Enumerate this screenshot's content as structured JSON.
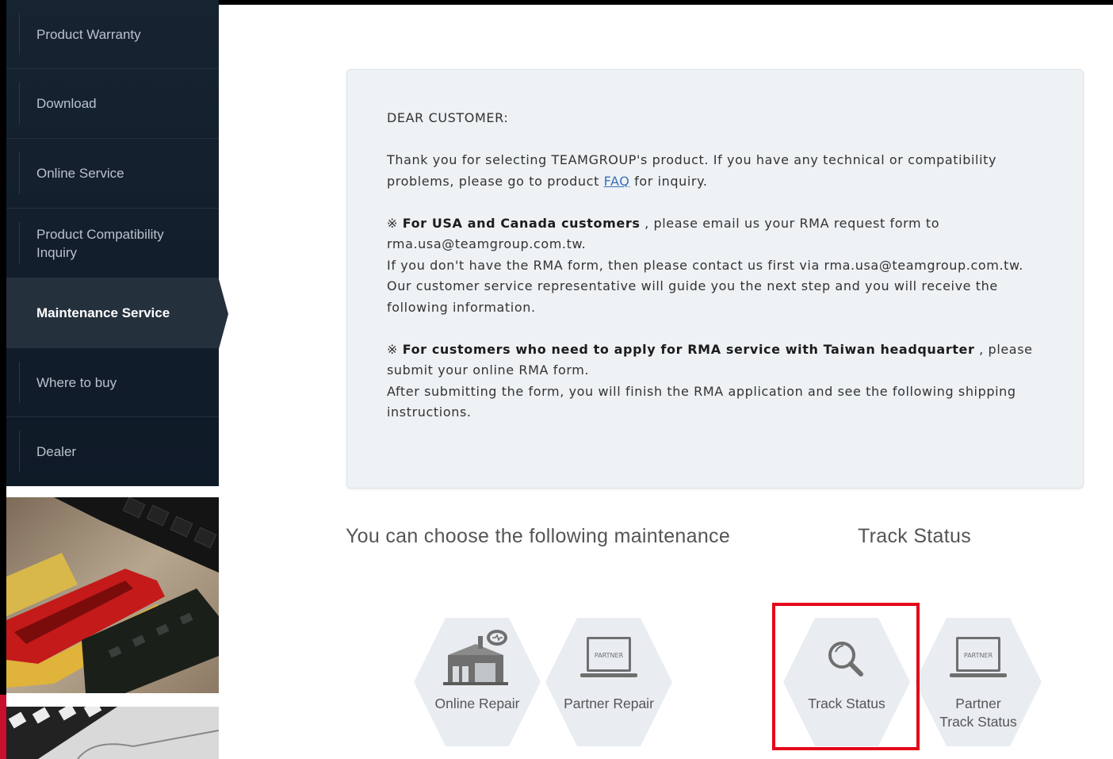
{
  "sidebar": {
    "items": [
      {
        "label": "Product Warranty"
      },
      {
        "label": "Download"
      },
      {
        "label": "Online Service"
      },
      {
        "label": "Product Compatibility Inquiry"
      },
      {
        "label": "Maintenance Service"
      },
      {
        "label": "Where to buy"
      },
      {
        "label": "Dealer"
      }
    ],
    "active_index": 4
  },
  "notice": {
    "greeting": "DEAR CUSTOMER:",
    "intro_pre": "Thank you for selecting TEAMGROUP's product. If you have any technical or compatibility problems, please go to product ",
    "faq_link": "FAQ",
    "intro_post": " for inquiry.",
    "usa_mark": "※ ",
    "usa_bold": "For USA and Canada customers",
    "usa_line1": " , please email us your RMA request form to rma.usa@teamgroup.com.tw.",
    "usa_line2": "If you don't have the RMA form, then please contact us first via rma.usa@teamgroup.com.tw.",
    "usa_line3": "Our customer service representative will guide you the next step and you will receive the following information.",
    "tw_mark": "※ ",
    "tw_bold": "For customers who need to apply for RMA service with Taiwan headquarter",
    "tw_line1": " , please submit your online RMA form.",
    "tw_line2": "After submitting the form, you will finish the RMA application and see the following shipping instructions."
  },
  "maintenance": {
    "title": "You can choose the following maintenance",
    "options": [
      {
        "label": "Online Repair",
        "icon": "repair-building-icon"
      },
      {
        "label": "Partner Repair",
        "icon": "partner-laptop-icon"
      }
    ]
  },
  "track": {
    "title": "Track Status",
    "options": [
      {
        "label": "Track Status",
        "icon": "search-icon"
      },
      {
        "label_line1": "Partner",
        "label_line2": "Track Status",
        "icon": "partner-laptop-icon"
      }
    ]
  },
  "icon_badge_text": "PARTNER",
  "colors": {
    "highlight": "#e3061a",
    "sidebar_bg": "#162331",
    "active_item_bg": "#25303d",
    "link": "#3b6fb6"
  }
}
